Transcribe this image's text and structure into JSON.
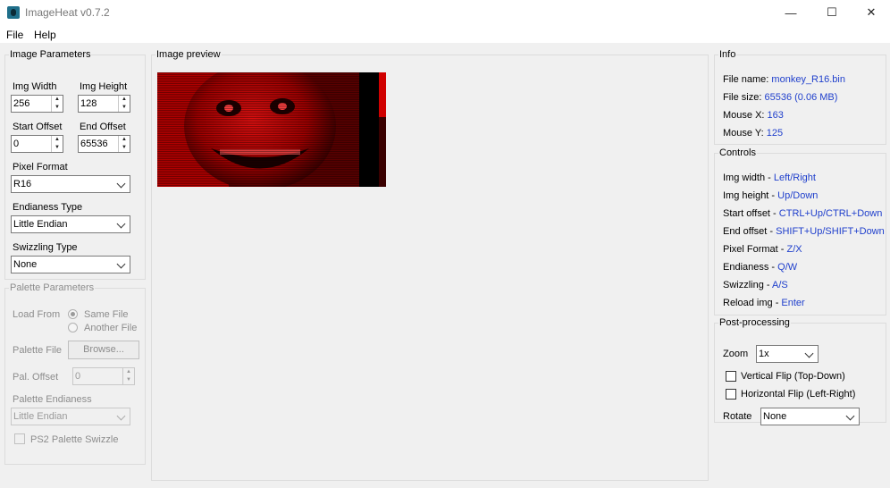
{
  "window": {
    "title": "ImageHeat v0.7.2",
    "min_glyph": "—",
    "max_glyph": "☐",
    "close_glyph": "✕"
  },
  "menu": {
    "file": "File",
    "help": "Help"
  },
  "image_params": {
    "title": "Image Parameters",
    "width_label": "Img Width",
    "width_value": "256",
    "height_label": "Img Height",
    "height_value": "128",
    "start_label": "Start Offset",
    "start_value": "0",
    "end_label": "End Offset",
    "end_value": "65536",
    "pixel_format_label": "Pixel Format",
    "pixel_format_value": "R16",
    "endianess_label": "Endianess Type",
    "endianess_value": "Little Endian",
    "swizzling_label": "Swizzling Type",
    "swizzling_value": "None"
  },
  "palette_params": {
    "title": "Palette Parameters",
    "load_from_label": "Load From",
    "same_file": "Same File",
    "another_file": "Another File",
    "palette_file_label": "Palette File",
    "browse": "Browse...",
    "pal_offset_label": "Pal. Offset",
    "pal_offset_value": "0",
    "pal_endianess_label": "Palette Endianess",
    "pal_endianess_value": "Little Endian",
    "ps2_swizzle": "PS2 Palette Swizzle"
  },
  "preview": {
    "title": "Image preview"
  },
  "info": {
    "title": "Info",
    "file_name_label": "File name: ",
    "file_name": "monkey_R16.bin",
    "file_size_label": "File size: ",
    "file_size": "65536 (0.06 MB)",
    "mouse_x_label": "Mouse X: ",
    "mouse_x": "163",
    "mouse_y_label": "Mouse Y: ",
    "mouse_y": "125"
  },
  "controls": {
    "title": "Controls",
    "items": [
      {
        "label": "Img width - ",
        "key": "Left/Right"
      },
      {
        "label": "Img height - ",
        "key": "Up/Down"
      },
      {
        "label": "Start offset - ",
        "key": "CTRL+Up/CTRL+Down"
      },
      {
        "label": "End offset - ",
        "key": "SHIFT+Up/SHIFT+Down"
      },
      {
        "label": "Pixel Format - ",
        "key": "Z/X"
      },
      {
        "label": "Endianess - ",
        "key": "Q/W"
      },
      {
        "label": "Swizzling - ",
        "key": "A/S"
      },
      {
        "label": "Reload img - ",
        "key": "Enter"
      }
    ]
  },
  "post": {
    "title": "Post-processing",
    "zoom_label": "Zoom",
    "zoom_value": "1x",
    "vflip": "Vertical Flip (Top-Down)",
    "hflip": "Horizontal Flip (Left-Right)",
    "rotate_label": "Rotate",
    "rotate_value": "None"
  },
  "colors": {
    "accent_text": "#1f3fcc",
    "image_red": "#c00000"
  }
}
